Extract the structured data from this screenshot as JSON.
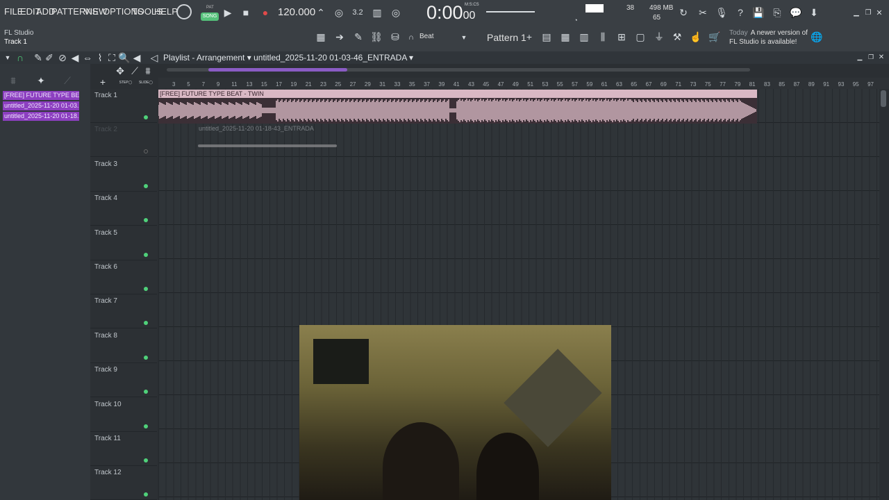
{
  "menu": [
    "FILE",
    "EDIT",
    "ADD",
    "PATTERNS",
    "VIEW",
    "OPTIONS",
    "TOOLS",
    "HELP"
  ],
  "transport": {
    "pat_label": "PAT",
    "song_label": "SONG",
    "bpm": "120.000",
    "time_main": "0:00",
    "time_sub": "00",
    "time_unit": "M:S:CS",
    "cpu": "38",
    "mem": "498 MB",
    "mem2": "65"
  },
  "hint": {
    "line1": "FL Studio",
    "line2": "Track 1"
  },
  "toolbar": {
    "beat_label": "Beat",
    "pattern_label": "Pattern 1"
  },
  "news": {
    "prefix": "Today",
    "line1": "A newer version of",
    "line2": "FL Studio is available!"
  },
  "playlist": {
    "title": "Playlist - Arrangement",
    "separator": "›",
    "project": "untitled_2025-11-20 01-03-46_ENTRADA"
  },
  "clips_panel": [
    "[FREE] FUTURE TYPE BE...",
    "untitled_2025-11-20 01-03...",
    "untitled_2025-11-20 01-18..."
  ],
  "tracks": [
    "Track 1",
    "Track 2",
    "Track 3",
    "Track 4",
    "Track 5",
    "Track 6",
    "Track 7",
    "Track 8",
    "Track 9",
    "Track 10",
    "Track 11",
    "Track 12"
  ],
  "ruler": [
    "3",
    "5",
    "7",
    "9",
    "11",
    "13",
    "15",
    "17",
    "19",
    "21",
    "23",
    "25",
    "27",
    "29",
    "31",
    "33",
    "35",
    "37",
    "39",
    "41",
    "43",
    "45",
    "47",
    "49",
    "51",
    "53",
    "55",
    "57",
    "59",
    "61",
    "63",
    "65",
    "67",
    "69",
    "71",
    "73",
    "75",
    "77",
    "79",
    "81",
    "83",
    "85",
    "87",
    "89",
    "91",
    "93",
    "95",
    "97"
  ],
  "clip1": {
    "name": "[FREE] FUTURE TYPE BEAT - TWIN"
  },
  "clip2": {
    "name": "untitled_2025-11-20 01-18-43_ENTRADA"
  },
  "colors": {
    "accent": "#8c3fc0",
    "led": "#4fd17a",
    "clip1": "#d9b8c4"
  }
}
